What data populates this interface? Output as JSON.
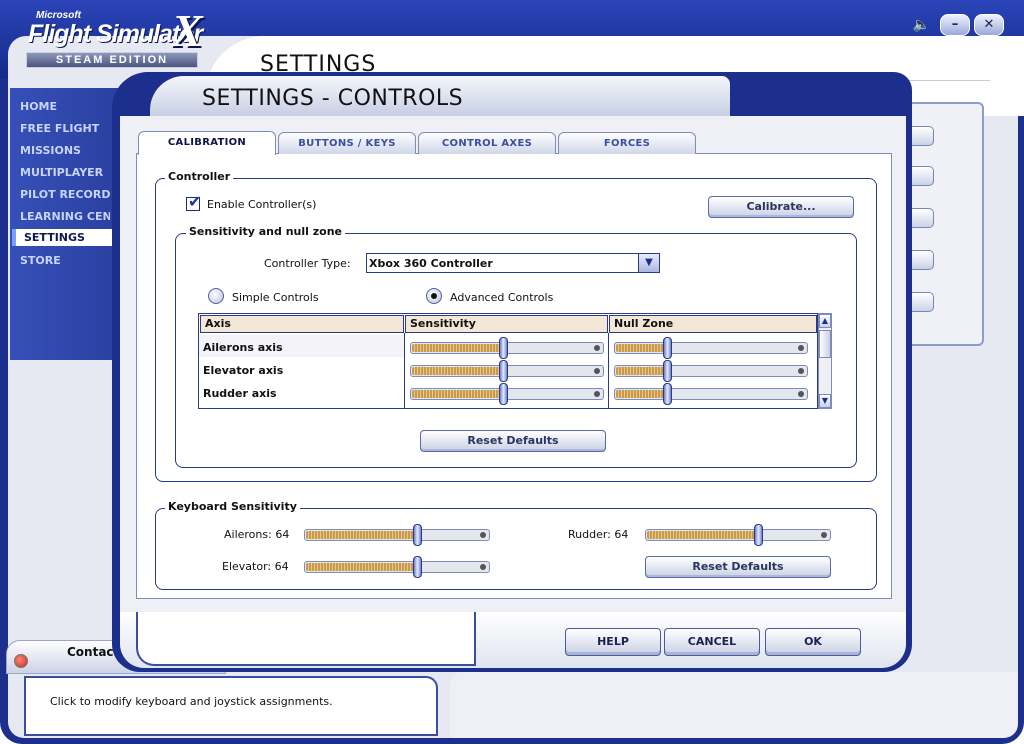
{
  "app": {
    "logo_brand": "Microsoft",
    "logo_title": "Flight Simulator",
    "logo_x": "X",
    "logo_edition": "STEAM EDITION",
    "page_heading": "SETTINGS"
  },
  "window_controls": {
    "sound_icon": "speaker-icon",
    "minimize_label": "–",
    "close_label": "✕"
  },
  "sidebar": {
    "items": [
      {
        "label": "HOME"
      },
      {
        "label": "FREE FLIGHT"
      },
      {
        "label": "MISSIONS"
      },
      {
        "label": "MULTIPLAYER"
      },
      {
        "label": "PILOT RECORDS"
      },
      {
        "label": "LEARNING CENT"
      },
      {
        "label": "SETTINGS",
        "active": true
      },
      {
        "label": "STORE"
      }
    ]
  },
  "contacts": {
    "label": "Contacts"
  },
  "status": {
    "text": "Click to modify keyboard and joystick assignments."
  },
  "dialog": {
    "title": "SETTINGS - CONTROLS",
    "tabs": [
      {
        "label": "CALIBRATION",
        "active": true
      },
      {
        "label": "BUTTONS / KEYS"
      },
      {
        "label": "CONTROL AXES"
      },
      {
        "label": "FORCES"
      }
    ],
    "controller": {
      "group_label": "Controller",
      "enable_label": "Enable Controller(s)",
      "enable_checked": true,
      "calibrate_label": "Calibrate..."
    },
    "sensitivity": {
      "group_label": "Sensitivity and null zone",
      "controller_type_label": "Controller Type:",
      "controller_type_value": "Xbox 360 Controller",
      "simple_label": "Simple Controls",
      "advanced_label": "Advanced Controls",
      "selected_mode": "advanced",
      "columns": [
        "Axis",
        "Sensitivity",
        "Null Zone"
      ],
      "rows": [
        {
          "axis": "Ailerons axis",
          "sensitivity": 0.5,
          "null_zone": 0.28
        },
        {
          "axis": "Elevator axis",
          "sensitivity": 0.5,
          "null_zone": 0.28
        },
        {
          "axis": "Rudder axis",
          "sensitivity": 0.5,
          "null_zone": 0.28
        }
      ],
      "reset_label": "Reset Defaults"
    },
    "keyboard": {
      "group_label": "Keyboard Sensitivity",
      "ailerons_label": "Ailerons: 64",
      "ailerons_value": 0.64,
      "elevator_label": "Elevator: 64",
      "elevator_value": 0.64,
      "rudder_label": "Rudder: 64",
      "rudder_value": 0.64,
      "reset_label": "Reset Defaults"
    },
    "footer": {
      "help_label": "HELP",
      "cancel_label": "CANCEL",
      "ok_label": "OK"
    }
  }
}
